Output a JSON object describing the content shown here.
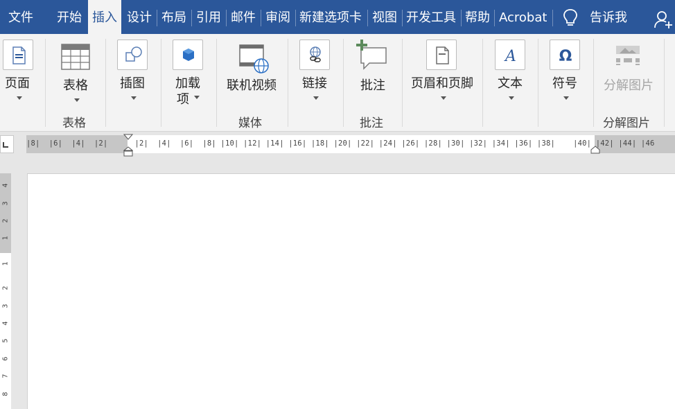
{
  "tabs": [
    {
      "label": "文件",
      "active": false
    },
    {
      "label": "开始",
      "active": false
    },
    {
      "label": "插入",
      "active": true
    },
    {
      "label": "设计",
      "active": false
    },
    {
      "label": "布局",
      "active": false
    },
    {
      "label": "引用",
      "active": false
    },
    {
      "label": "邮件",
      "active": false
    },
    {
      "label": "审阅",
      "active": false
    },
    {
      "label": "新建选项卡",
      "active": false
    },
    {
      "label": "视图",
      "active": false
    },
    {
      "label": "开发工具",
      "active": false
    },
    {
      "label": "帮助",
      "active": false
    },
    {
      "label": "Acrobat",
      "active": false
    }
  ],
  "tell_me": "告诉我",
  "ribbon": {
    "pages": {
      "label": "页面",
      "icon": "page-icon"
    },
    "table": {
      "label": "表格",
      "icon": "table-icon"
    },
    "table_group": "表格",
    "illustrations": {
      "label": "插图",
      "icon": "shapes-icon"
    },
    "addins": {
      "label1": "加载",
      "label2": "项",
      "icon": "addin-icon"
    },
    "online_video": {
      "label": "联机视频",
      "icon": "online-video-icon"
    },
    "media_group": "媒体",
    "links": {
      "label": "链接",
      "icon": "link-icon"
    },
    "comment": {
      "label": "批注",
      "icon": "comment-icon"
    },
    "comment_group": "批注",
    "header_footer": {
      "label": "页眉和页脚",
      "icon": "header-footer-icon"
    },
    "text": {
      "label": "文本",
      "icon": "text-icon"
    },
    "symbols": {
      "label": "符号",
      "icon": "omega-icon"
    },
    "split_image": {
      "label": "分解图片",
      "icon": "split-image-icon"
    },
    "split_group": "分解图片"
  },
  "ruler": {
    "horizontal": "|8|  |6|  |4|  |2|      |2|  |4|  |6|  |8| |10| |12| |14| |16| |18| |20| |22| |24| |26| |28| |30| |32| |34| |36| |38|    |40| |42| |44| |46",
    "vertical": [
      "4",
      "3",
      "2",
      "1",
      "",
      "1",
      "2",
      "3",
      "4",
      "5",
      "6",
      "7",
      "8"
    ]
  },
  "colors": {
    "brand": "#2b579a",
    "ribbon_bg": "#f3f3f3"
  }
}
